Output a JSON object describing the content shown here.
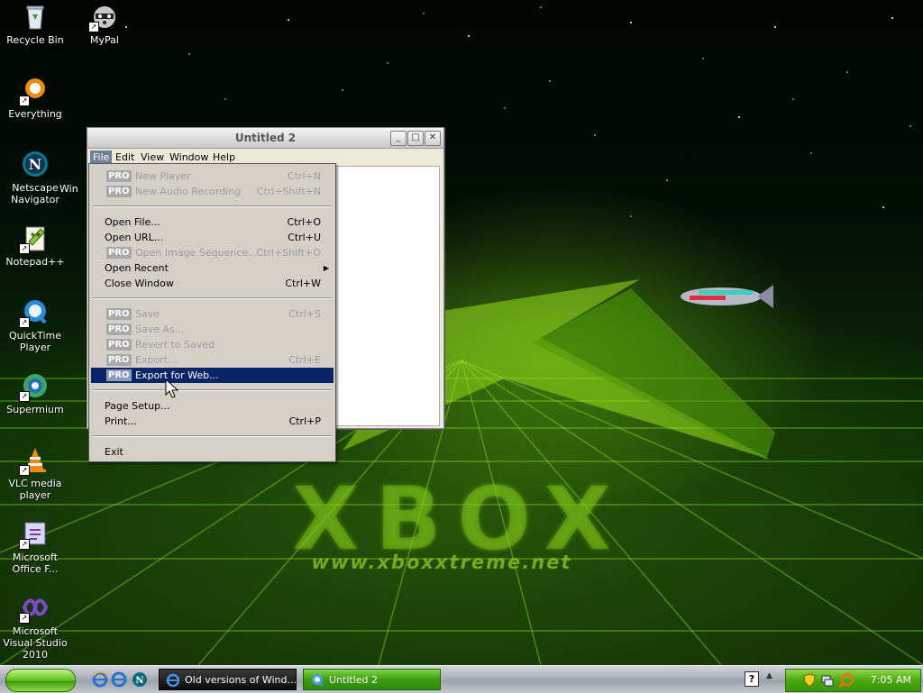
{
  "desktop": {
    "wallpaper": {
      "logo_text": "XBOX",
      "url_text": "www.xboxxtreme.net"
    },
    "icons": [
      {
        "label": "Recycle Bin",
        "icon": "recycle-bin-icon"
      },
      {
        "label": "MyPal",
        "icon": "raccoon-icon"
      },
      {
        "label": "Everything",
        "icon": "everything-search-icon"
      },
      {
        "label": "Netscape Navigator",
        "icon": "netscape-icon"
      },
      {
        "label": "Win",
        "icon": "windows-icon"
      },
      {
        "label": "Notepad++",
        "icon": "notepadpp-icon"
      },
      {
        "label": "QuickTime Player",
        "icon": "quicktime-icon"
      },
      {
        "label": "Supermium",
        "icon": "supermium-icon"
      },
      {
        "label": "VLC media player",
        "icon": "vlc-cone-icon"
      },
      {
        "label": "Microsoft Office F...",
        "icon": "office-icon"
      },
      {
        "label": "Microsoft Visual Studio 2010",
        "icon": "visual-studio-icon"
      }
    ]
  },
  "window": {
    "title": "Untitled 2",
    "menubar": [
      "File",
      "Edit",
      "View",
      "Window",
      "Help"
    ],
    "active_menu": "File"
  },
  "file_menu": {
    "pro_badge": "PRO",
    "items": [
      {
        "label": "New Player",
        "shortcut": "Ctrl+N",
        "pro": true,
        "enabled": false
      },
      {
        "label": "New Audio Recording",
        "shortcut": "Ctrl+Shift+N",
        "pro": true,
        "enabled": false
      },
      {
        "label": "Open File...",
        "shortcut": "Ctrl+O",
        "pro": false,
        "enabled": true
      },
      {
        "label": "Open URL...",
        "shortcut": "Ctrl+U",
        "pro": false,
        "enabled": true
      },
      {
        "label": "Open Image Sequence...",
        "shortcut": "Ctrl+Shift+O",
        "pro": true,
        "enabled": false
      },
      {
        "label": "Open Recent",
        "shortcut": "",
        "pro": false,
        "enabled": true,
        "submenu": true
      },
      {
        "label": "Close Window",
        "shortcut": "Ctrl+W",
        "pro": false,
        "enabled": true
      },
      {
        "label": "Save",
        "shortcut": "Ctrl+S",
        "pro": true,
        "enabled": false
      },
      {
        "label": "Save As...",
        "shortcut": "",
        "pro": true,
        "enabled": false
      },
      {
        "label": "Revert to Saved",
        "shortcut": "",
        "pro": true,
        "enabled": false
      },
      {
        "label": "Export...",
        "shortcut": "Ctrl+E",
        "pro": true,
        "enabled": false
      },
      {
        "label": "Export for Web...",
        "shortcut": "",
        "pro": true,
        "enabled": false,
        "highlighted": true
      },
      {
        "label": "Page Setup...",
        "shortcut": "",
        "pro": false,
        "enabled": true
      },
      {
        "label": "Print...",
        "shortcut": "Ctrl+P",
        "pro": false,
        "enabled": true
      },
      {
        "label": "Exit",
        "shortcut": "",
        "pro": false,
        "enabled": true
      }
    ]
  },
  "taskbar": {
    "tasks": [
      {
        "label": "Old versions of Wind...",
        "icon": "internet-explorer-icon",
        "active": false
      },
      {
        "label": "Untitled 2",
        "icon": "quicktime-icon",
        "active": true
      }
    ],
    "quick_launch": [
      "internet-explorer-icon",
      "internet-explorer-icon",
      "netscape-icon"
    ],
    "clock": "7:05 AM"
  },
  "colors": {
    "menu_highlight": "#0a246a",
    "taskbar_green": "#4aa814",
    "disabled_text": "#9d9d9d"
  }
}
